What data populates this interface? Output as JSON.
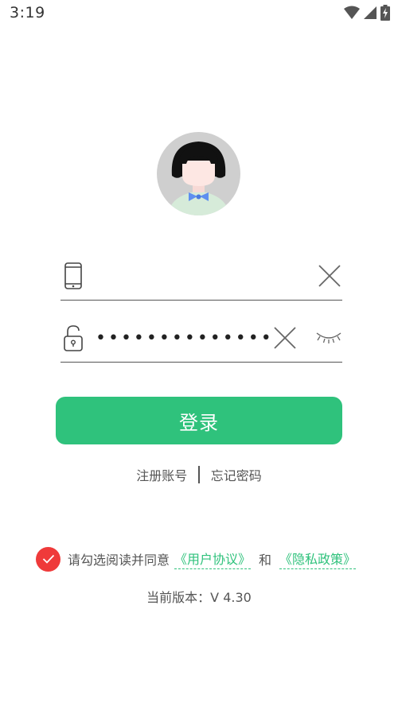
{
  "status_bar": {
    "time": "3:19"
  },
  "form": {
    "phone": {
      "value": "",
      "icon": "phone-icon"
    },
    "password": {
      "masked_value": "••••••••••••••",
      "icon": "lock-icon"
    }
  },
  "login_button": {
    "label": "登录"
  },
  "links": {
    "register": "注册账号",
    "forgot_password": "忘记密码"
  },
  "agreement": {
    "checked": true,
    "prefix": "请勾选阅读并同意",
    "user_agreement": "《用户协议》",
    "and": "和",
    "privacy_policy": "《隐私政策》"
  },
  "version": {
    "text": "当前版本：V 4.30"
  },
  "colors": {
    "accent": "#2fc27c",
    "check": "#ef3a3a",
    "text": "#555555"
  }
}
